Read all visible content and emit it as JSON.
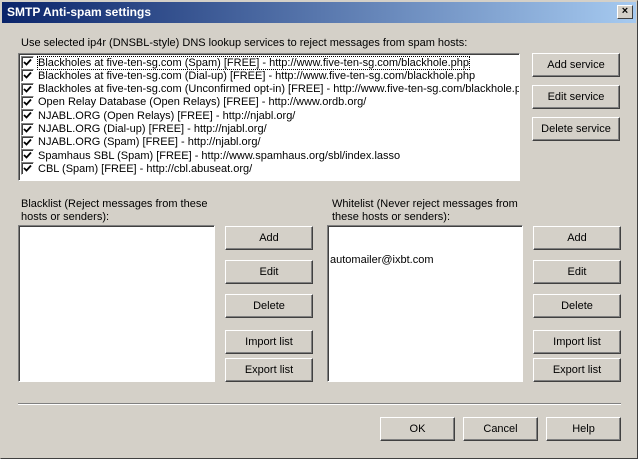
{
  "window": {
    "title": "SMTP Anti-spam settings",
    "close_glyph": "×"
  },
  "services": {
    "label": "Use selected ip4r (DNSBL-style) DNS lookup services to reject messages from spam hosts:",
    "items": [
      {
        "text": "Blackholes at five-ten-sg.com (Spam) [FREE] - http://www.five-ten-sg.com/blackhole.php",
        "checked": true
      },
      {
        "text": "Blackholes at five-ten-sg.com (Dial-up) [FREE] - http://www.five-ten-sg.com/blackhole.php",
        "checked": true
      },
      {
        "text": "Blackholes at five-ten-sg.com (Unconfirmed opt-in) [FREE] - http://www.five-ten-sg.com/blackhole.php",
        "checked": true
      },
      {
        "text": "Open Relay Database (Open Relays) [FREE] - http://www.ordb.org/",
        "checked": true
      },
      {
        "text": "NJABL.ORG (Open Relays) [FREE] - http://njabl.org/",
        "checked": true
      },
      {
        "text": "NJABL.ORG (Dial-up) [FREE] - http://njabl.org/",
        "checked": true
      },
      {
        "text": "NJABL.ORG (Spam) [FREE] - http://njabl.org/",
        "checked": true
      },
      {
        "text": "Spamhaus SBL (Spam) [FREE] - http://www.spamhaus.org/sbl/index.lasso",
        "checked": true
      },
      {
        "text": "CBL (Spam) [FREE] - http://cbl.abuseat.org/",
        "checked": true
      }
    ],
    "add_label": "Add service",
    "edit_label": "Edit service",
    "delete_label": "Delete service"
  },
  "blacklist": {
    "label_line1": "Blacklist (Reject messages from these",
    "label_line2": "hosts or senders):",
    "entries": [],
    "add_label": "Add",
    "edit_label": "Edit",
    "delete_label": "Delete",
    "import_label": "Import list",
    "export_label": "Export list"
  },
  "whitelist": {
    "label_line1": "Whitelist (Never reject messages from",
    "label_line2": "these hosts or senders):",
    "entries": [
      "automailer@ixbt.com"
    ],
    "add_label": "Add",
    "edit_label": "Edit",
    "delete_label": "Delete",
    "import_label": "Import list",
    "export_label": "Export list"
  },
  "footer": {
    "ok_label": "OK",
    "cancel_label": "Cancel",
    "help_label": "Help"
  }
}
